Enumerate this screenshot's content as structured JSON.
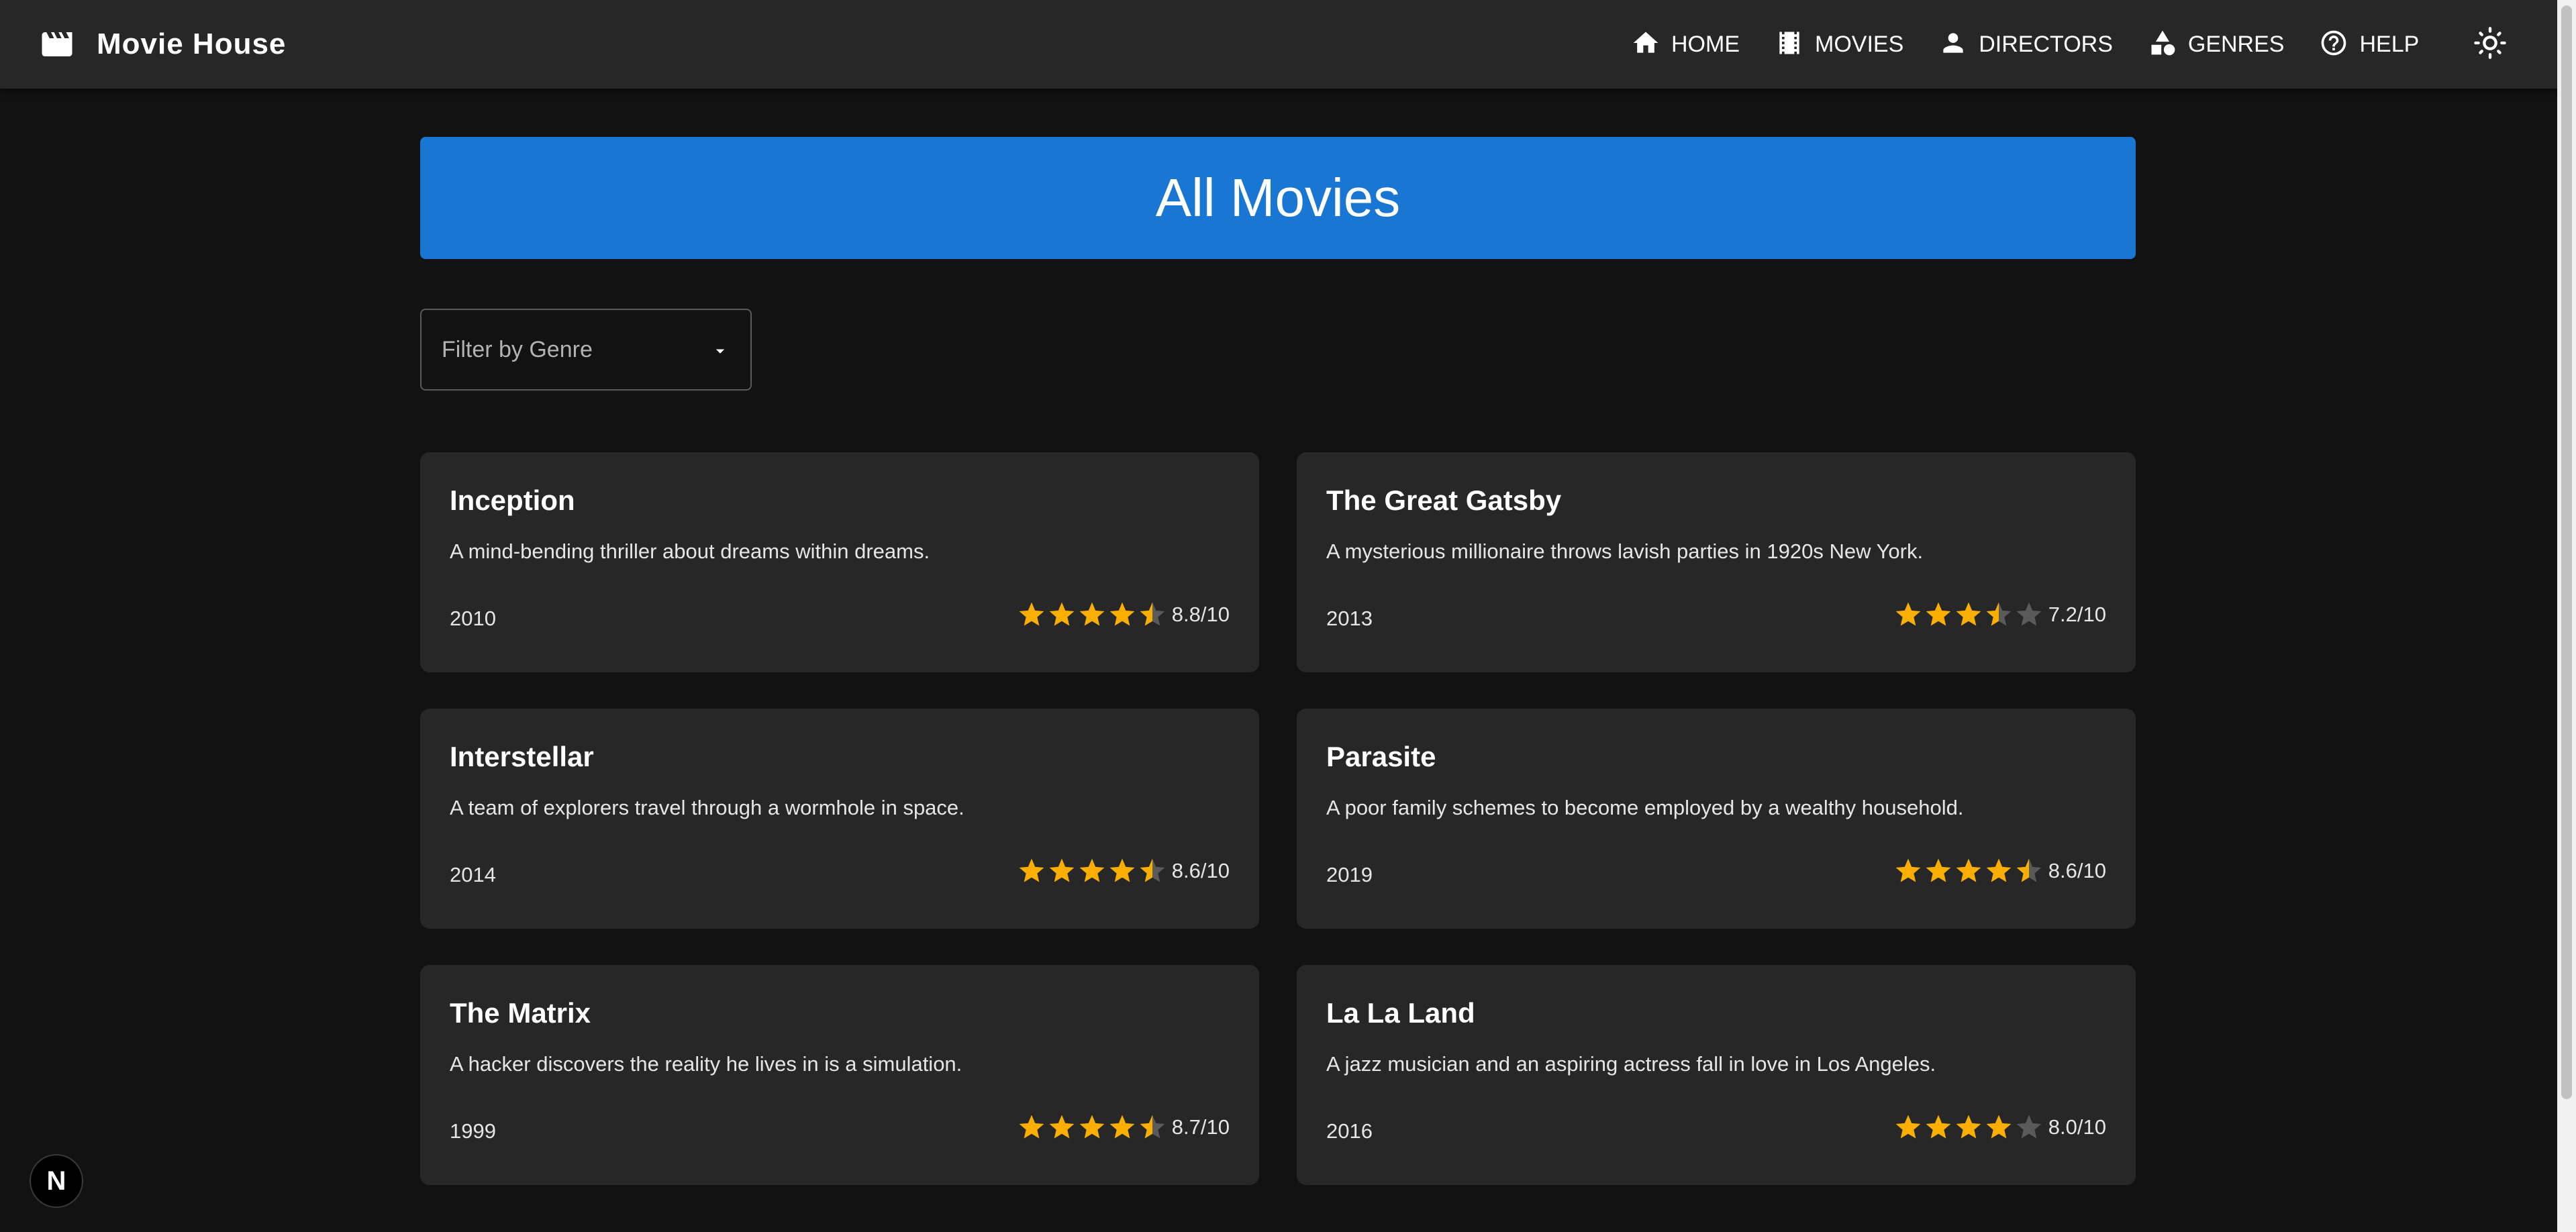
{
  "app": {
    "title": "Movie House",
    "brand_icon": "movie-clapper-icon"
  },
  "nav": [
    {
      "label": "HOME",
      "icon": "home-icon"
    },
    {
      "label": "MOVIES",
      "icon": "film-icon"
    },
    {
      "label": "DIRECTORS",
      "icon": "person-icon"
    },
    {
      "label": "GENRES",
      "icon": "category-icon"
    },
    {
      "label": "HELP",
      "icon": "help-circle-icon"
    }
  ],
  "theme_toggle_icon": "sun-icon",
  "page": {
    "title": "All Movies"
  },
  "filter": {
    "label": "Filter by Genre",
    "icon": "caret-down-icon"
  },
  "movies": [
    {
      "title": "Inception",
      "description": "A mind-bending thriller about dreams within dreams.",
      "year": "2010",
      "rating": 8.8,
      "rating_text": "8.8/10"
    },
    {
      "title": "The Great Gatsby",
      "description": "A mysterious millionaire throws lavish parties in 1920s New York.",
      "year": "2013",
      "rating": 7.2,
      "rating_text": "7.2/10"
    },
    {
      "title": "Interstellar",
      "description": "A team of explorers travel through a wormhole in space.",
      "year": "2014",
      "rating": 8.6,
      "rating_text": "8.6/10"
    },
    {
      "title": "Parasite",
      "description": "A poor family schemes to become employed by a wealthy household.",
      "year": "2019",
      "rating": 8.6,
      "rating_text": "8.6/10"
    },
    {
      "title": "The Matrix",
      "description": "A hacker discovers the reality he lives in is a simulation.",
      "year": "1999",
      "rating": 8.7,
      "rating_text": "8.7/10"
    },
    {
      "title": "La La Land",
      "description": "A jazz musician and an aspiring actress fall in love in Los Angeles.",
      "year": "2016",
      "rating": 8.0,
      "rating_text": "8.0/10"
    }
  ],
  "colors": {
    "accent": "#1976d2",
    "star": "#faaf00",
    "star_empty": "#5a5a5a",
    "background": "#121212",
    "surface": "#272727"
  },
  "dev_badge": {
    "letter": "N"
  }
}
